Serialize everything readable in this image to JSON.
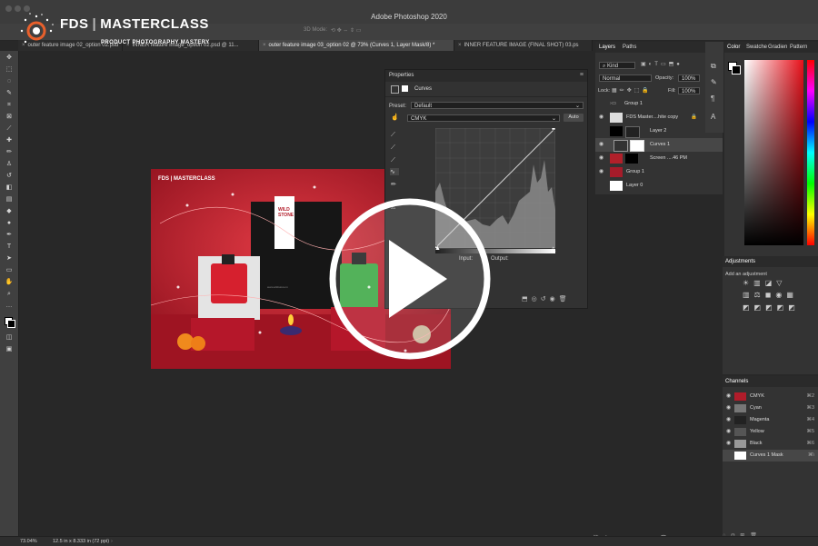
{
  "app": {
    "title": "Adobe Photoshop 2020"
  },
  "logo": {
    "brand": "FDS",
    "name": "MASTERCLASS",
    "subtitle": "PRODUCT PHOTOGRAPHY MASTERY"
  },
  "options_bar": {
    "mode_label": "3D Mode:"
  },
  "doc_tabs": [
    {
      "label": "outer feature image 02_option 02.psd"
    },
    {
      "label": "INNER feature image_option 02.psd @ 11..."
    },
    {
      "label": "outer feature image 03_option 02 @ 73% (Curves 1, Layer Mask/8) *"
    },
    {
      "label": "INNER FEATURE IMAGE (FINAL SHOT) 03.ps"
    }
  ],
  "properties": {
    "title": "Properties",
    "adjustment": "Curves",
    "preset_label": "Preset:",
    "preset_value": "Default",
    "channel_value": "CMYK",
    "auto_label": "Auto",
    "input_label": "Input:",
    "output_label": "Output:"
  },
  "layers_panel": {
    "tabs": [
      "Layers",
      "Paths"
    ],
    "filter_label": "Kind",
    "blend_mode": "Normal",
    "opacity_label": "Opacity:",
    "opacity_value": "100%",
    "lock_label": "Lock:",
    "fill_label": "Fill:",
    "fill_value": "100%",
    "layers": [
      {
        "name": "Group 1"
      },
      {
        "name": "FDS Master....hite copy"
      },
      {
        "name": "Layer 2"
      },
      {
        "name": "Curves 1"
      },
      {
        "name": "Screen ....46 PM"
      },
      {
        "name": "Group 1"
      },
      {
        "name": "Layer 0"
      }
    ]
  },
  "color_panel": {
    "tabs": [
      "Color",
      "Swatche",
      "Gradien",
      "Pattern"
    ]
  },
  "adjustments_panel": {
    "title": "Adjustments",
    "hint": "Add an adjustment"
  },
  "channels_panel": {
    "title": "Channels",
    "channels": [
      {
        "name": "CMYK",
        "key": "⌘2"
      },
      {
        "name": "Cyan",
        "key": "⌘3"
      },
      {
        "name": "Magenta",
        "key": "⌘4"
      },
      {
        "name": "Yellow",
        "key": "⌘5"
      },
      {
        "name": "Black",
        "key": "⌘6"
      },
      {
        "name": "Curves 1 Mask",
        "key": "⌘\\"
      }
    ]
  },
  "status": {
    "zoom": "73.04%",
    "doc_size": "12.5 in x 8.333 in (72 ppi)"
  },
  "canvas_image": {
    "brand": "FDS",
    "name": "MASTERCLASS",
    "product_label": "WILD STONE",
    "web": "www.wildstone.in"
  },
  "colors": {
    "accent_red": "#c21d2c",
    "panel_bg": "#333333",
    "workspace_bg": "#282828"
  }
}
